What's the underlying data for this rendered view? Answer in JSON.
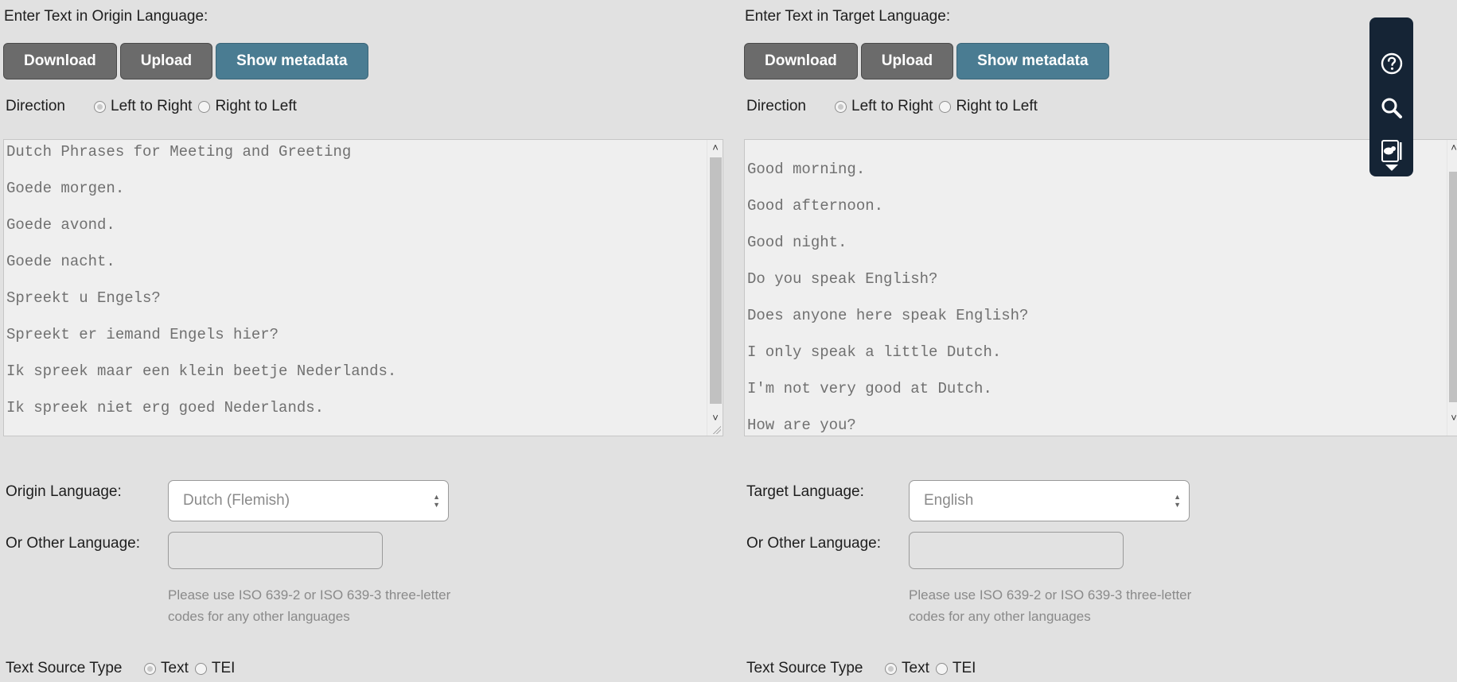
{
  "origin": {
    "title": "Enter Text in Origin Language:",
    "buttons": {
      "download": "Download",
      "upload": "Upload",
      "metadata": "Show metadata"
    },
    "direction": {
      "label": "Direction",
      "ltr": "Left to Right",
      "rtl": "Right to Left",
      "selected": "ltr"
    },
    "text_lines": [
      "Dutch Phrases for Meeting and Greeting",
      "Goede morgen.",
      "Goede avond.",
      "Goede nacht.",
      "Spreekt u Engels?",
      "Spreekt er iemand Engels hier?",
      "Ik spreek maar een klein beetje Nederlands.",
      "Ik spreek niet erg goed Nederlands."
    ],
    "language_label": "Origin Language:",
    "language_value": "Dutch (Flemish)",
    "other_label": "Or Other Language:",
    "other_value": "",
    "hint": "Please use ISO 639-2 or ISO 639-3 three-letter codes for any other languages",
    "source": {
      "label": "Text Source Type",
      "text": "Text",
      "tei": "TEI",
      "selected": "text"
    }
  },
  "target": {
    "title": "Enter Text in Target Language:",
    "buttons": {
      "download": "Download",
      "upload": "Upload",
      "metadata": "Show metadata"
    },
    "direction": {
      "label": "Direction",
      "ltr": "Left to Right",
      "rtl": "Right to Left",
      "selected": "ltr"
    },
    "text_lines": [
      "",
      "Good morning.",
      "Good afternoon.",
      "Good night.",
      "Do you speak English?",
      "Does anyone here speak English?",
      "I only speak a little Dutch.",
      "I'm not very good at Dutch.",
      "How are you?"
    ],
    "language_label": "Target Language:",
    "language_value": "English",
    "other_label": "Or Other Language:",
    "other_value": "",
    "hint": "Please use ISO 639-2 or ISO 639-3 three-letter codes for any other languages",
    "source": {
      "label": "Text Source Type",
      "text": "Text",
      "tei": "TEI",
      "selected": "text"
    }
  },
  "toolbar": {
    "icons": [
      "help-icon",
      "search-icon",
      "annotation-icon"
    ],
    "colors": {
      "background": "#152435",
      "icon": "#ffffff"
    }
  },
  "colors": {
    "page_background": "#e1e1e1",
    "button_gray": "#6b6b6b",
    "button_metadata": "#4a7c92"
  }
}
